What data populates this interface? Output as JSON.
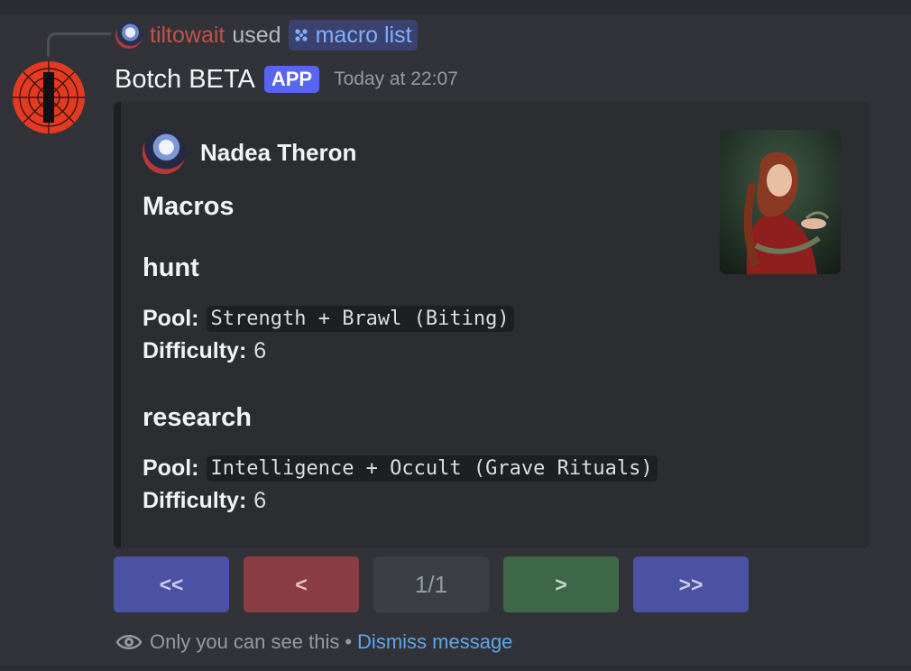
{
  "reply": {
    "username": "tiltowait",
    "used_text": "used",
    "command": "macro list"
  },
  "message": {
    "author": "Botch BETA",
    "badge": "APP",
    "timestamp": "Today at 22:07"
  },
  "embed": {
    "author_name": "Nadea Theron",
    "title": "Macros",
    "fields": [
      {
        "name": "hunt",
        "pool_label": "Pool:",
        "pool": "Strength + Brawl (Biting)",
        "difficulty_label": "Difficulty:",
        "difficulty": "6"
      },
      {
        "name": "research",
        "pool_label": "Pool:",
        "pool": "Intelligence + Occult (Grave Rituals)",
        "difficulty_label": "Difficulty:",
        "difficulty": "6"
      }
    ]
  },
  "buttons": {
    "first": "<<",
    "prev": "<",
    "page": "1/1",
    "next": ">",
    "last": ">>"
  },
  "footer": {
    "notice": "Only you can see this",
    "separator": "•",
    "dismiss": "Dismiss message"
  },
  "colors": {
    "background": "#323339",
    "embed_bg": "#2b2d31",
    "button_primary": "#4c52a3",
    "button_danger": "#8a3e43",
    "button_secondary": "#3c3e45",
    "button_success": "#3e6748",
    "link": "#5ba6f0",
    "badge": "#5865f2"
  },
  "icons": {
    "command": "slash-command-icon",
    "visibility": "eye-icon"
  }
}
